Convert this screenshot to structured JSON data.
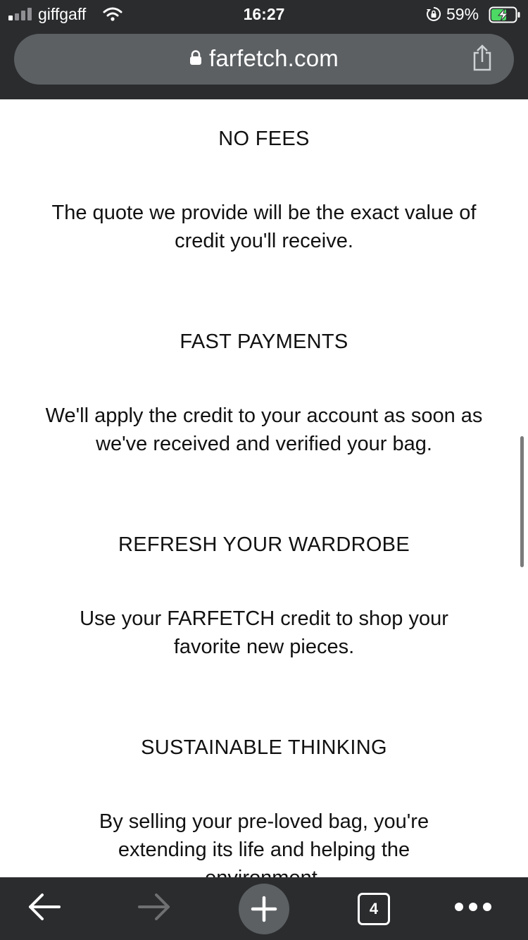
{
  "status_bar": {
    "carrier": "giffgaff",
    "time": "16:27",
    "battery": "59%",
    "icons": [
      "signal-icon",
      "wifi-icon",
      "orientation-lock-icon",
      "battery-charging-icon"
    ]
  },
  "browser": {
    "url": "farfetch.com",
    "icons": [
      "padlock-icon",
      "share-icon"
    ]
  },
  "content": {
    "sections": [
      {
        "heading": "NO FEES",
        "body": "The quote we provide will be the exact value of credit you'll receive."
      },
      {
        "heading": "FAST PAYMENTS",
        "body": "We'll apply the credit to your account as soon as we've received and verified your bag."
      },
      {
        "heading": "REFRESH YOUR WARDROBE",
        "body": "Use your FARFETCH credit to shop your favorite new pieces."
      },
      {
        "heading": "SUSTAINABLE THINKING",
        "body": "By selling your pre-loved bag, you're extending its life and helping the environment."
      }
    ]
  },
  "toolbar": {
    "tab_count": "4",
    "icons": [
      "back-arrow-icon",
      "forward-arrow-icon",
      "new-tab-plus-icon",
      "tabs-icon",
      "more-icon"
    ]
  },
  "colors": {
    "chrome_bg": "#2b2c2e",
    "urlbar_bg": "#5c6063",
    "battery_green": "#4cd964",
    "text": "#111111"
  }
}
